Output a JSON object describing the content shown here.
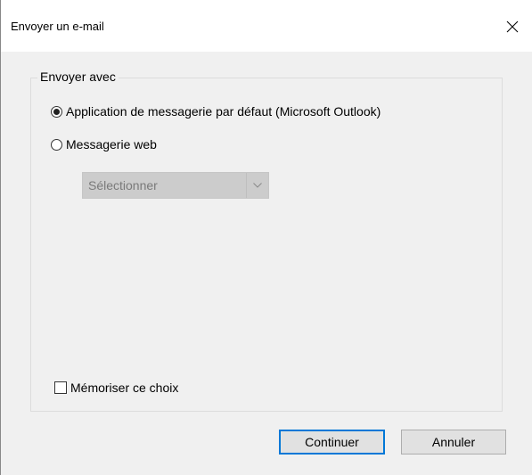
{
  "window": {
    "title": "Envoyer un e-mail",
    "close_icon": "close-icon"
  },
  "group": {
    "legend": "Envoyer avec",
    "options": [
      {
        "label": "Application de messagerie par défaut (Microsoft Outlook)",
        "selected": true
      },
      {
        "label": "Messagerie web",
        "selected": false
      }
    ],
    "webmail_select": {
      "value": "Sélectionner",
      "enabled": false
    },
    "remember": {
      "label": "Mémoriser ce choix",
      "checked": false
    }
  },
  "buttons": {
    "continue": "Continuer",
    "cancel": "Annuler"
  },
  "colors": {
    "accent": "#0078d7",
    "dialog_bg": "#f0f0f0",
    "disabled_select_bg": "#cccccc"
  }
}
